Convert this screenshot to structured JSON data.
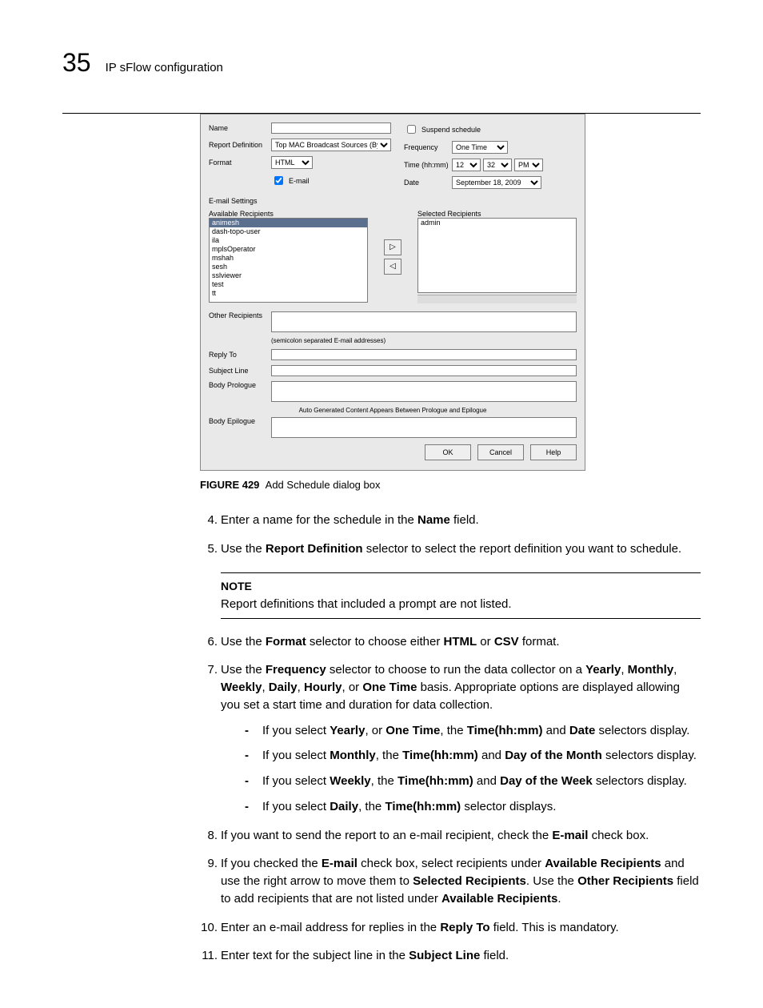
{
  "header": {
    "chapter_number": "35",
    "chapter_title": "IP sFlow configuration"
  },
  "dialog": {
    "labels": {
      "name": "Name",
      "report_def": "Report Definition",
      "format": "Format",
      "email_settings": "E-mail Settings",
      "available": "Available Recipients",
      "selected": "Selected Recipients",
      "other": "Other Recipients",
      "reply_to": "Reply To",
      "subject": "Subject Line",
      "prologue": "Body Prologue",
      "epilogue": "Body Epilogue",
      "suspend": "Suspend schedule",
      "frequency": "Frequency",
      "time": "Time (hh:mm)",
      "date": "Date",
      "email_checkbox": "E-mail"
    },
    "values": {
      "report_def": "Top MAC Broadcast Sources (By Frames)",
      "format": "HTML",
      "frequency": "One Time",
      "hour": "12",
      "minute": "32",
      "ampm": "PM",
      "date": "September 18, 2009"
    },
    "hints": {
      "other": "(semicolon separated E-mail addresses)",
      "autogen": "Auto Generated Content Appears Between Prologue and Epilogue"
    },
    "available_list": [
      "animesh",
      "dash-topo-user",
      "ila",
      "mplsOperator",
      "mshah",
      "sesh",
      "sslviewer",
      "test",
      "tt"
    ],
    "selected_list": [
      "admin"
    ],
    "buttons": {
      "ok": "OK",
      "cancel": "Cancel",
      "help": "Help"
    },
    "move": {
      "right": "▷",
      "left": "◁"
    }
  },
  "figure": {
    "label": "FIGURE 429",
    "caption": "Add Schedule dialog box"
  },
  "steps": {
    "s4": {
      "num": "4.",
      "pre": "Enter a name for the schedule in the ",
      "b1": "Name",
      "post": " field."
    },
    "s5": {
      "num": "5.",
      "pre": "Use the ",
      "b1": "Report Definition",
      "post": " selector to select the report definition you want to schedule."
    },
    "note": {
      "head": "NOTE",
      "body": "Report definitions that included a prompt are not listed."
    },
    "s6": {
      "num": "6.",
      "t1": "Use the ",
      "b1": "Format",
      "t2": " selector to choose either ",
      "b2": "HTML",
      "t3": " or ",
      "b3": "CSV",
      "t4": " format."
    },
    "s7": {
      "num": "7.",
      "t1": "Use the ",
      "b1": "Frequency",
      "t2": " selector to choose to run the data collector on a ",
      "b2": "Yearly",
      "c1": ", ",
      "b3": "Monthly",
      "c2": ", ",
      "b4": "Weekly",
      "c3": ", ",
      "b5": "Daily",
      "c4": ", ",
      "b6": "Hourly",
      "c5": ", or ",
      "b7": "One Time",
      "t3": " basis. Appropriate options are displayed allowing you set a start time and duration for data collection.",
      "d1": {
        "t1": "If you select ",
        "b1": "Yearly",
        "t2": ", or ",
        "b2": "One Time",
        "t3": ", the ",
        "b3": "Time(hh:mm)",
        "t4": " and ",
        "b4": "Date",
        "t5": " selectors display."
      },
      "d2": {
        "t1": "If you select ",
        "b1": "Monthly",
        "t2": ", the ",
        "b2": "Time(hh:mm)",
        "t3": " and ",
        "b3": "Day of the Month",
        "t4": " selectors display."
      },
      "d3": {
        "t1": "If you select ",
        "b1": "Weekly",
        "t2": ", the ",
        "b2": "Time(hh:mm)",
        "t3": " and ",
        "b3": "Day of the Week",
        "t4": " selectors display."
      },
      "d4": {
        "t1": "If you select ",
        "b1": "Daily",
        "t2": ", the ",
        "b2": "Time(hh:mm)",
        "t3": " selector displays."
      }
    },
    "s8": {
      "num": "8.",
      "t1": "If you want to send the report to an e-mail recipient, check the ",
      "b1": "E-mail",
      "t2": " check box."
    },
    "s9": {
      "num": "9.",
      "t1": "If you checked the ",
      "b1": "E-mail",
      "t2": " check box, select recipients under ",
      "b2": "Available Recipients",
      "t3": " and use the right arrow to move them to ",
      "b3": "Selected Recipients",
      "t4": ". Use the ",
      "b4": "Other Recipients",
      "t5": " field to add recipients that are not listed under ",
      "b5": "Available Recipients",
      "t6": "."
    },
    "s10": {
      "num": "10.",
      "t1": "Enter an e-mail address for replies in the ",
      "b1": "Reply To",
      "t2": " field. This is mandatory."
    },
    "s11": {
      "num": "11.",
      "t1": "Enter text for the subject line in the ",
      "b1": "Subject Line",
      "t2": " field."
    }
  }
}
